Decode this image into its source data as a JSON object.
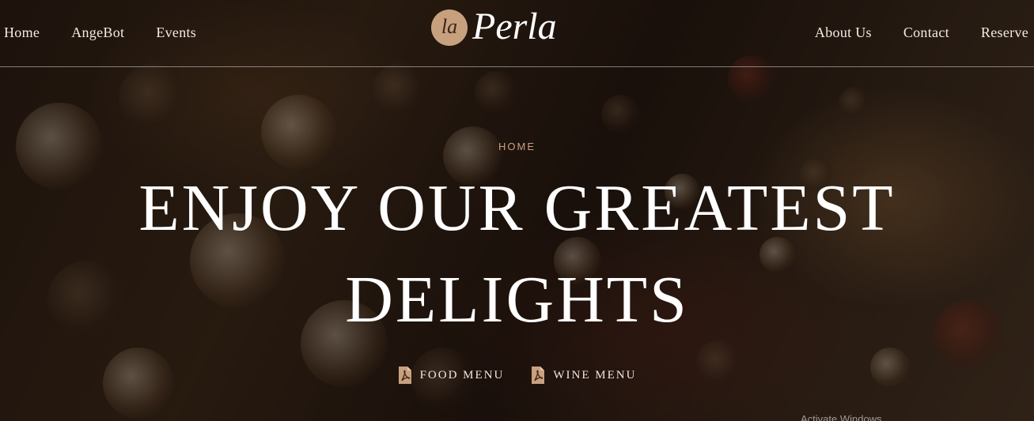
{
  "header": {
    "nav_left": [
      "Home",
      "AngeBot",
      "Events"
    ],
    "nav_right": [
      "About Us",
      "Contact",
      "Reserve"
    ],
    "logo": {
      "badge": "la",
      "word": "Perla"
    }
  },
  "hero": {
    "breadcrumb": "HOME",
    "headline": "ENJOY OUR GREATEST DELIGHTS",
    "menus": [
      {
        "label": "FOOD MENU",
        "icon": "pdf-icon"
      },
      {
        "label": "WINE MENU",
        "icon": "pdf-icon"
      }
    ],
    "corner_text": "Activate Windows"
  },
  "colors": {
    "accent": "#c9a07f",
    "logo_badge": "#c7a07e",
    "text": "#ffffff"
  }
}
